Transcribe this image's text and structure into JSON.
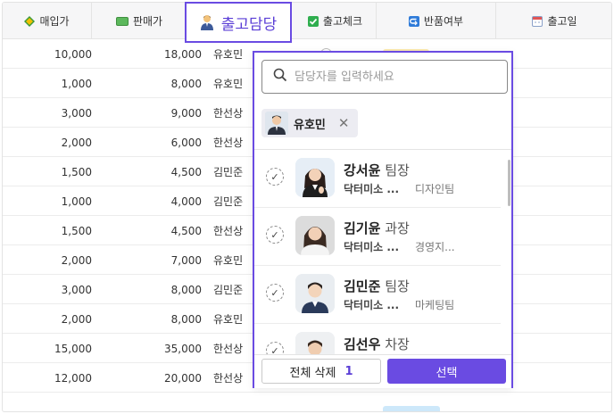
{
  "columns": {
    "purchase_price": {
      "label": "매입가",
      "icon": "diamond-icon"
    },
    "sale_price": {
      "label": "판매가",
      "icon": "money-icon"
    },
    "shipping_manager": {
      "label": "출고담당",
      "icon": "person-icon"
    },
    "shipping_check": {
      "label": "출고체크",
      "icon": "checkbox-icon"
    },
    "return_status": {
      "label": "반품여부",
      "icon": "return-arrow-icon"
    },
    "shipping_date": {
      "label": "출고일",
      "icon": "calendar-icon"
    }
  },
  "rows": [
    {
      "purchase": "10,000",
      "sale": "18,000",
      "manager": "유호민"
    },
    {
      "purchase": "1,000",
      "sale": "8,000",
      "manager": "유호민"
    },
    {
      "purchase": "3,000",
      "sale": "9,000",
      "manager": "한선상"
    },
    {
      "purchase": "2,000",
      "sale": "6,000",
      "manager": "한선상"
    },
    {
      "purchase": "1,500",
      "sale": "4,500",
      "manager": "김민준"
    },
    {
      "purchase": "1,000",
      "sale": "4,000",
      "manager": "김민준"
    },
    {
      "purchase": "1,500",
      "sale": "4,500",
      "manager": "한선상"
    },
    {
      "purchase": "2,000",
      "sale": "7,000",
      "manager": "유호민"
    },
    {
      "purchase": "3,000",
      "sale": "8,000",
      "manager": "김민준"
    },
    {
      "purchase": "2,000",
      "sale": "8,000",
      "manager": "유호민"
    },
    {
      "purchase": "15,000",
      "sale": "35,000",
      "manager": "한선상"
    },
    {
      "purchase": "12,000",
      "sale": "20,000",
      "manager": "한선상"
    }
  ],
  "dropdown": {
    "search_placeholder": "담당자를 입력하세요",
    "selected": [
      {
        "name": "유호민"
      }
    ],
    "people": [
      {
        "name": "강서윤",
        "title": "팀장",
        "company": "닥터미소 ...",
        "dept": "디자인팀"
      },
      {
        "name": "김기윤",
        "title": "과장",
        "company": "닥터미소 ...",
        "dept": "경영지..."
      },
      {
        "name": "김민준",
        "title": "팀장",
        "company": "닥터미소 ...",
        "dept": "마케팅팀"
      },
      {
        "name": "김선우",
        "title": "차장",
        "company": "",
        "dept": ""
      }
    ],
    "clear_label": "전체 삭제",
    "selected_count": "1",
    "confirm_label": "선택"
  },
  "colors": {
    "accent": "#6a4be2"
  }
}
